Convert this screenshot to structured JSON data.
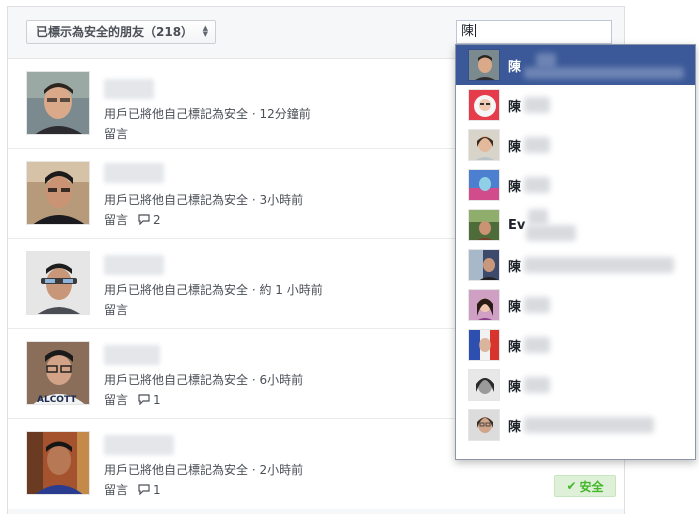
{
  "header": {
    "filter_label": "已標示為安全的朋友（218）",
    "search_value": "陳"
  },
  "friends": [
    {
      "status": "用戶已將他自己標記為安全 · 12分鐘前",
      "comment_label": "留言",
      "comment_count": ""
    },
    {
      "status": "用戶已將他自己標記為安全 · 3小時前",
      "comment_label": "留言",
      "comment_count": "2"
    },
    {
      "status": "用戶已將他自己標記為安全 · 約 1 小時前",
      "comment_label": "留言",
      "comment_count": ""
    },
    {
      "status": "用戶已將他自己標記為安全 · 6小時前",
      "comment_label": "留言",
      "comment_count": "1"
    },
    {
      "status": "用戶已將他自己標記為安全 · 2小時前",
      "comment_label": "留言",
      "comment_count": "1"
    }
  ],
  "safe_badge": {
    "label": "安全",
    "icon": "check-icon"
  },
  "dropdown": {
    "items": [
      {
        "name": "陳"
      },
      {
        "name": "陳"
      },
      {
        "name": "陳"
      },
      {
        "name": "陳"
      },
      {
        "name": "Ev"
      },
      {
        "name": "陳"
      },
      {
        "name": "陳"
      },
      {
        "name": "陳"
      },
      {
        "name": "陳"
      },
      {
        "name": "陳"
      }
    ]
  },
  "colors": {
    "accent": "#3b5998",
    "safe_green": "#42b72a",
    "panel_bg": "#f6f7f9"
  }
}
